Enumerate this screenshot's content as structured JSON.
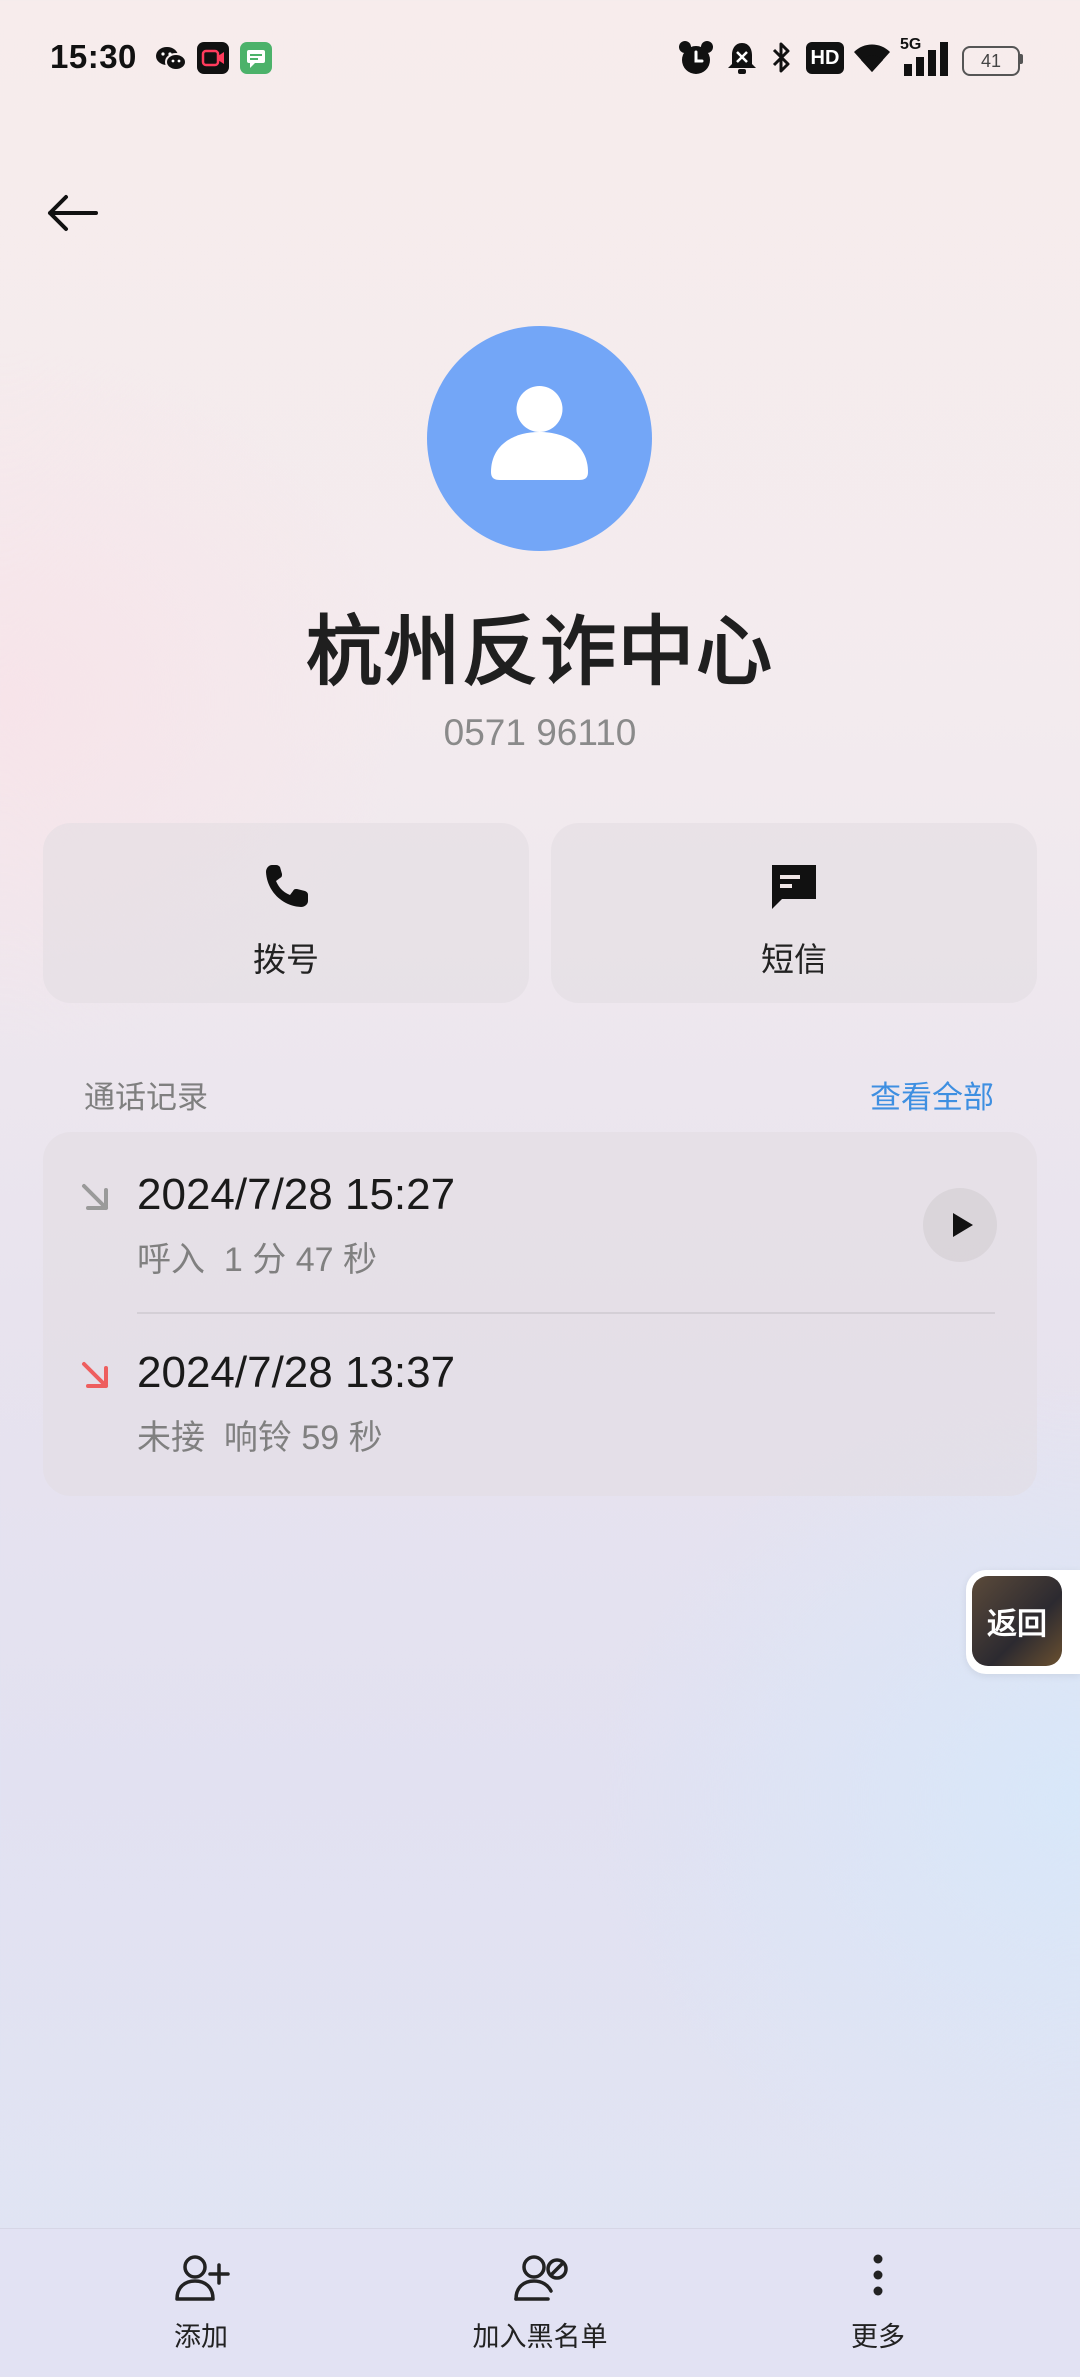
{
  "status_bar": {
    "time": "15:30",
    "battery": "41",
    "network": "5G",
    "hd": "HD",
    "left_icons": [
      "wechat-icon",
      "video-app-icon",
      "message-app-icon"
    ],
    "right_icons": [
      "alarm-icon",
      "mute-icon",
      "bluetooth-icon",
      "hd-icon",
      "wifi-icon",
      "signal-icon",
      "battery-icon"
    ]
  },
  "contact": {
    "name": "杭州反诈中心",
    "number": "0571 96110",
    "avatar_color": "#73a6f7"
  },
  "actions": [
    {
      "label": "拨号",
      "icon": "phone-icon"
    },
    {
      "label": "短信",
      "icon": "message-icon"
    }
  ],
  "call_log": {
    "title": "通话记录",
    "view_all": "查看全部",
    "items": [
      {
        "datetime": "2024/7/28 15:27",
        "detail": "呼入  1 分 47 秒",
        "type": "incoming",
        "icon_color": "#9a9a9a",
        "has_play": true
      },
      {
        "datetime": "2024/7/28 13:37",
        "detail": "未接  响铃 59 秒",
        "type": "missed",
        "icon_color": "#ee5e5e",
        "has_play": false
      }
    ]
  },
  "floating": {
    "label": "返回"
  },
  "bottom_bar": [
    {
      "label": "添加",
      "icon": "add-contact-icon"
    },
    {
      "label": "加入黑名单",
      "icon": "block-contact-icon"
    },
    {
      "label": "更多",
      "icon": "more-vertical-icon"
    }
  ],
  "colors": {
    "accent": "#3e8fe1",
    "missed": "#ee5e5e"
  }
}
